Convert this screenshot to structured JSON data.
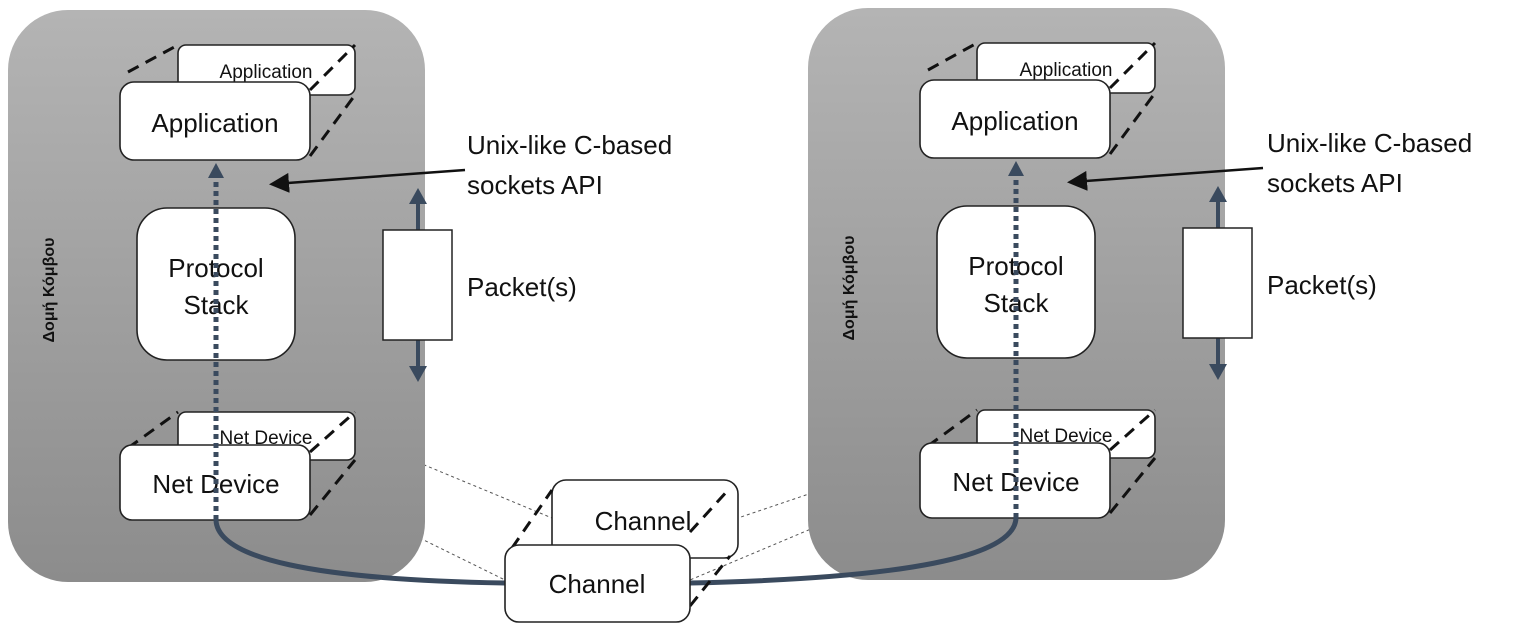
{
  "node_label": "Δομή Κόμβου",
  "application": "Application",
  "protocol_stack": [
    "Protocol",
    "Stack"
  ],
  "net_device": "Net Device",
  "channel": "Channel",
  "api_label": [
    "Unix-like C-based",
    "sockets API"
  ],
  "packets_label": "Packet(s)",
  "colors": {
    "node_fill_top": "#b4b4b4",
    "node_fill_bottom": "#8c8c8c",
    "link": "#3a4a5e"
  }
}
